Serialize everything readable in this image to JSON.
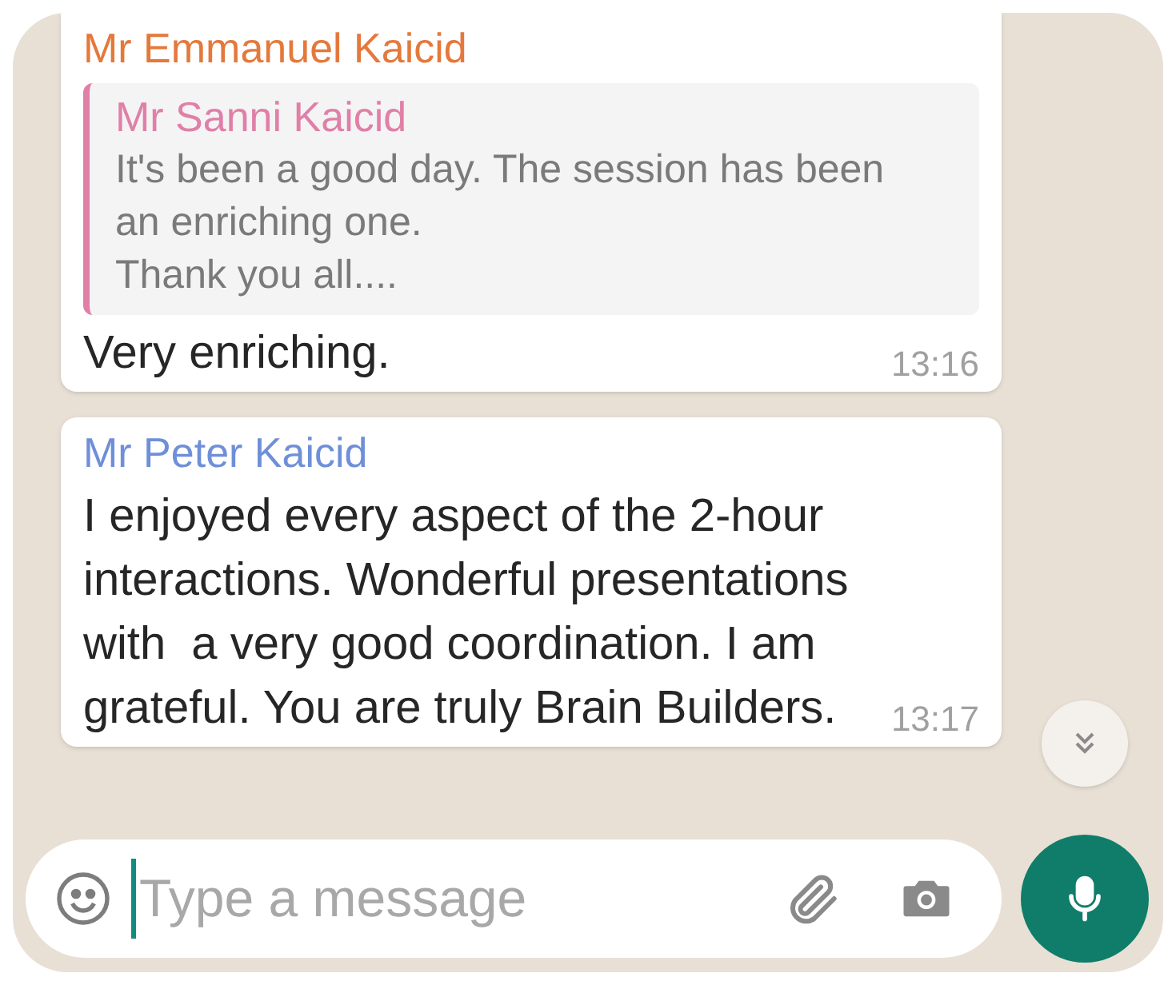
{
  "messages": [
    {
      "sender": "Mr Emmanuel Kaicid",
      "color": "#e4793b",
      "quote": {
        "sender": "Mr Sanni Kaicid",
        "color": "#e07fa8",
        "text": "It's been a good day. The session has been\nan enriching one.\nThank you all...."
      },
      "text": "Very enriching.",
      "time": "13:16"
    },
    {
      "sender": "Mr Peter Kaicid",
      "color": "#6f8fd8",
      "text": "I enjoyed every aspect of the 2-hour\ninteractions. Wonderful presentations\nwith  a very good coordination. I am\ngrateful. You are truly Brain Builders.",
      "time": "13:17"
    }
  ],
  "composer": {
    "placeholder": "Type a message"
  }
}
